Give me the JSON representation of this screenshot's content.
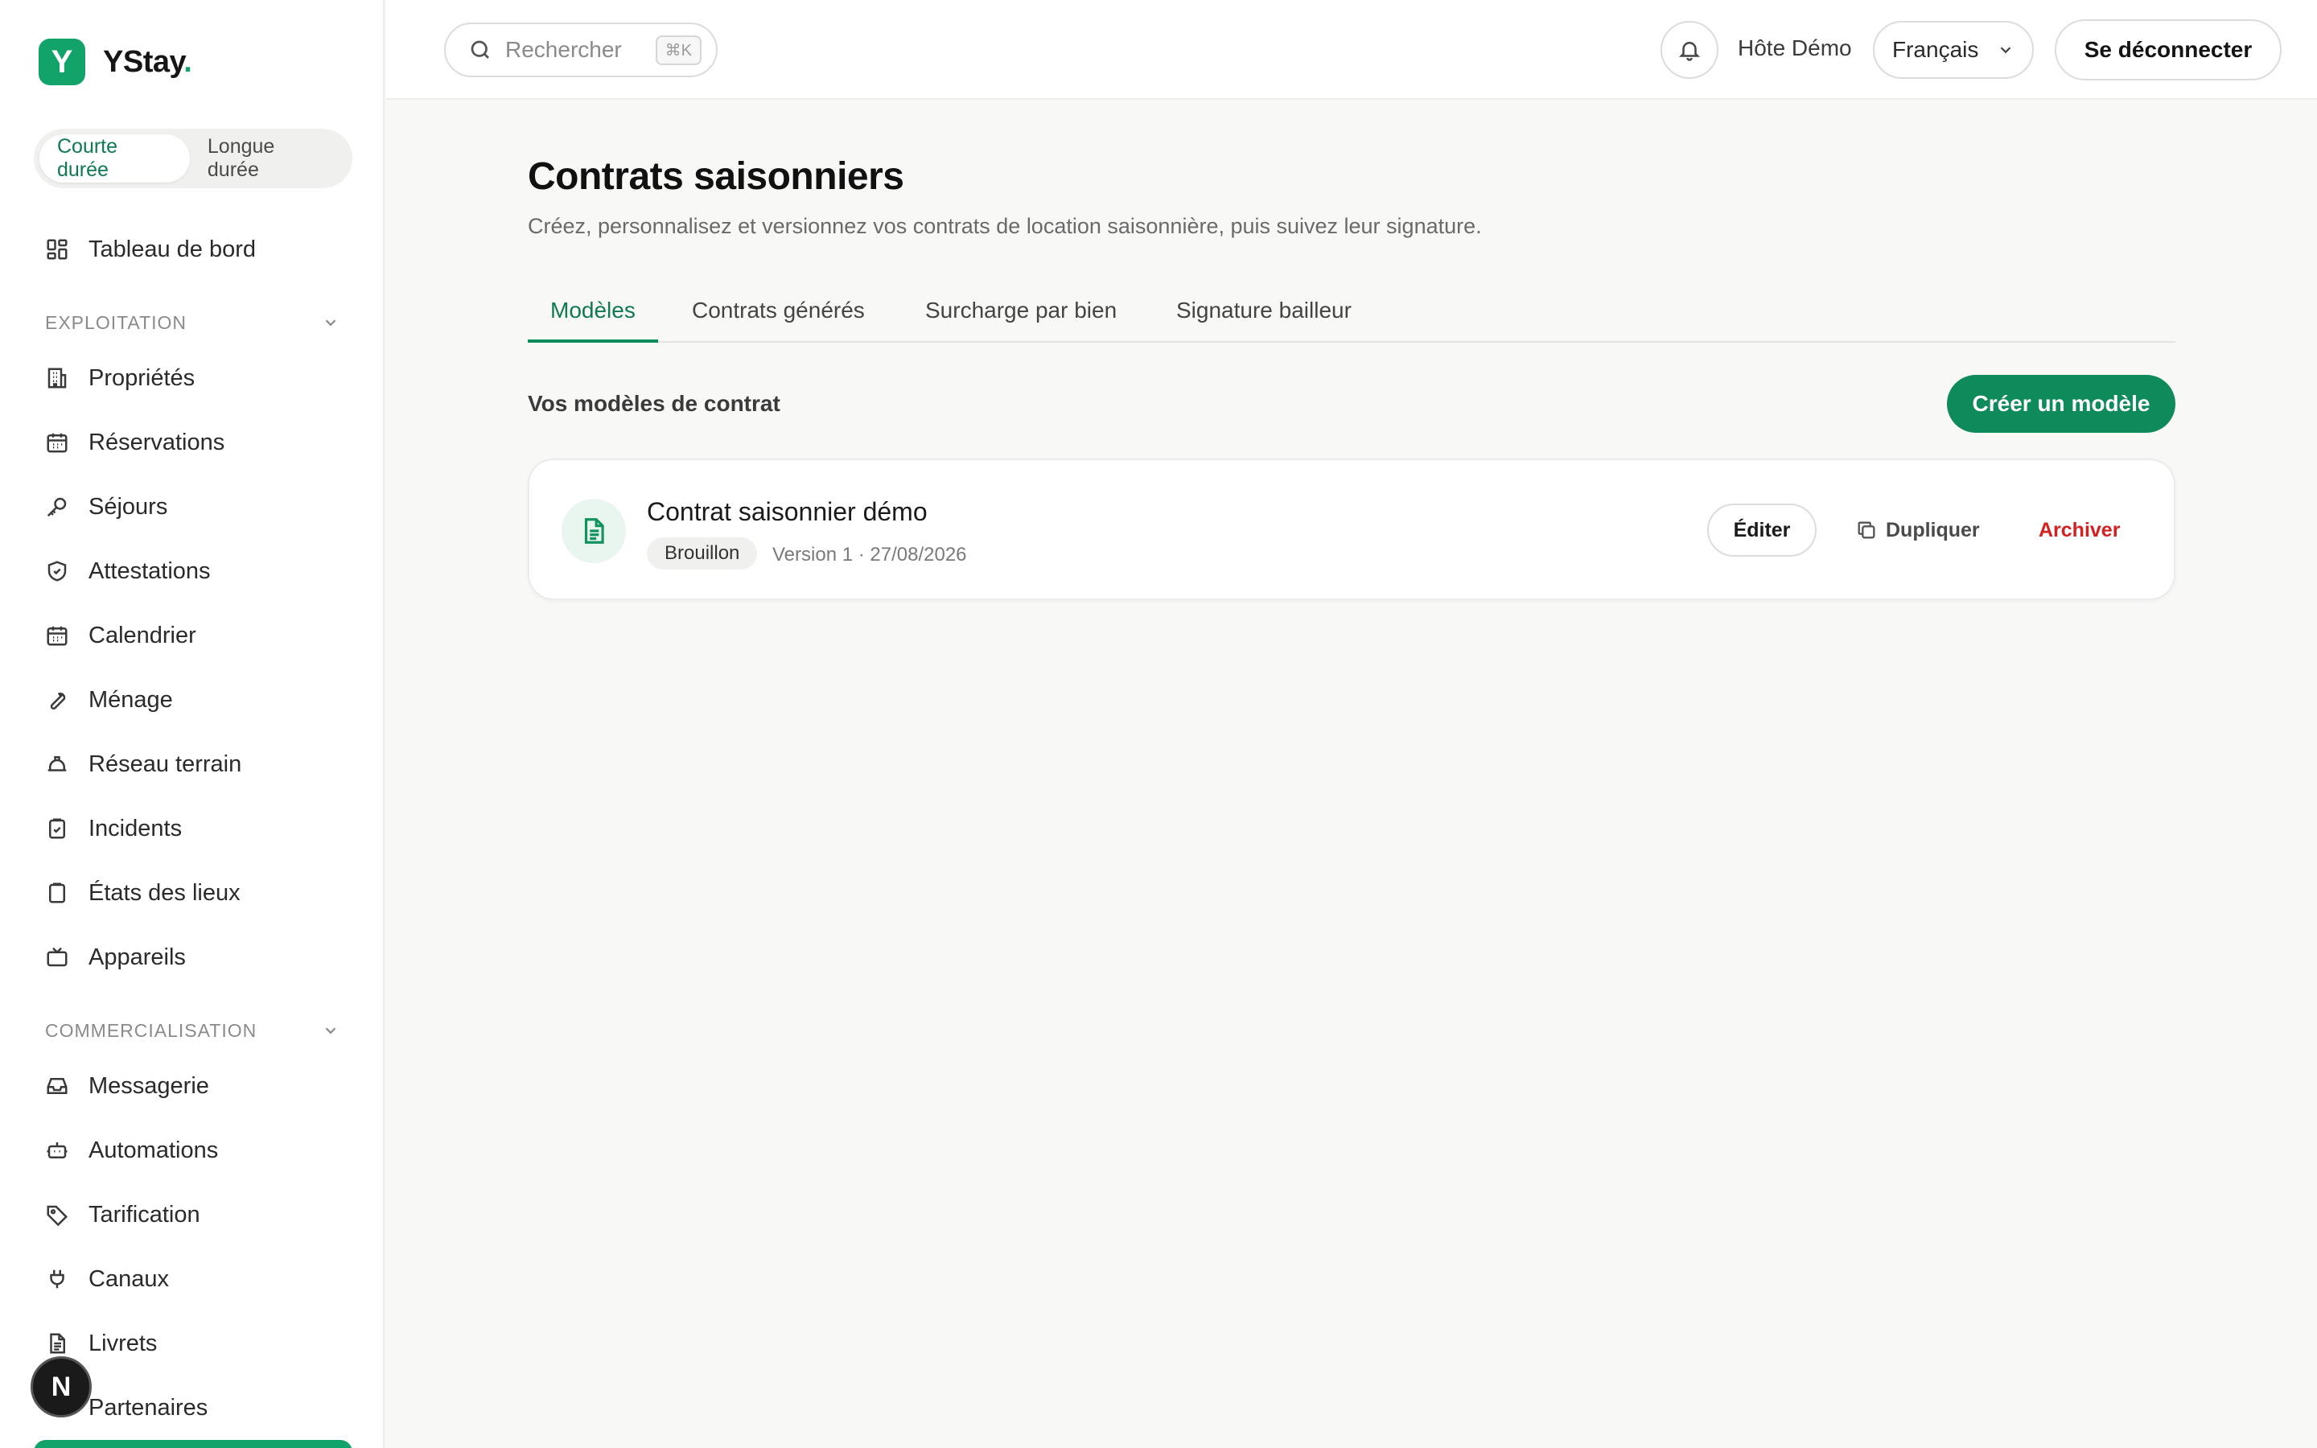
{
  "brand": {
    "name": "YStay",
    "dot": ".",
    "mark": "Y",
    "accent": "#12a36b"
  },
  "mode_toggle": {
    "short": "Courte durée",
    "long": "Longue durée"
  },
  "sidebar": {
    "dashboard": "Tableau de bord",
    "section_operations": "EXPLOITATION",
    "operations": [
      "Propriétés",
      "Réservations",
      "Séjours",
      "Attestations",
      "Calendrier",
      "Ménage",
      "Réseau terrain",
      "Incidents",
      "États des lieux",
      "Appareils"
    ],
    "section_marketing": "COMMERCIALISATION",
    "marketing": [
      "Messagerie",
      "Automations",
      "Tarification",
      "Canaux",
      "Livrets",
      "Partenaires"
    ]
  },
  "nextjs_badge": "N",
  "topbar": {
    "search_placeholder": "Rechercher",
    "search_shortcut": "⌘K",
    "host_name": "Hôte Démo",
    "language": "Français",
    "logout": "Se déconnecter"
  },
  "page": {
    "title": "Contrats saisonniers",
    "subtitle": "Créez, personnalisez et versionnez vos contrats de location saisonnière, puis suivez leur signature."
  },
  "tabs": [
    "Modèles",
    "Contrats générés",
    "Surcharge par bien",
    "Signature bailleur"
  ],
  "templates": {
    "section_title": "Vos modèles de contrat",
    "create_label": "Créer un modèle",
    "items": [
      {
        "title": "Contrat saisonnier démo",
        "status": "Brouillon",
        "meta": "Version 1  · 27/08/2026",
        "edit": "Éditer",
        "duplicate": "Dupliquer",
        "archive": "Archiver"
      }
    ]
  }
}
